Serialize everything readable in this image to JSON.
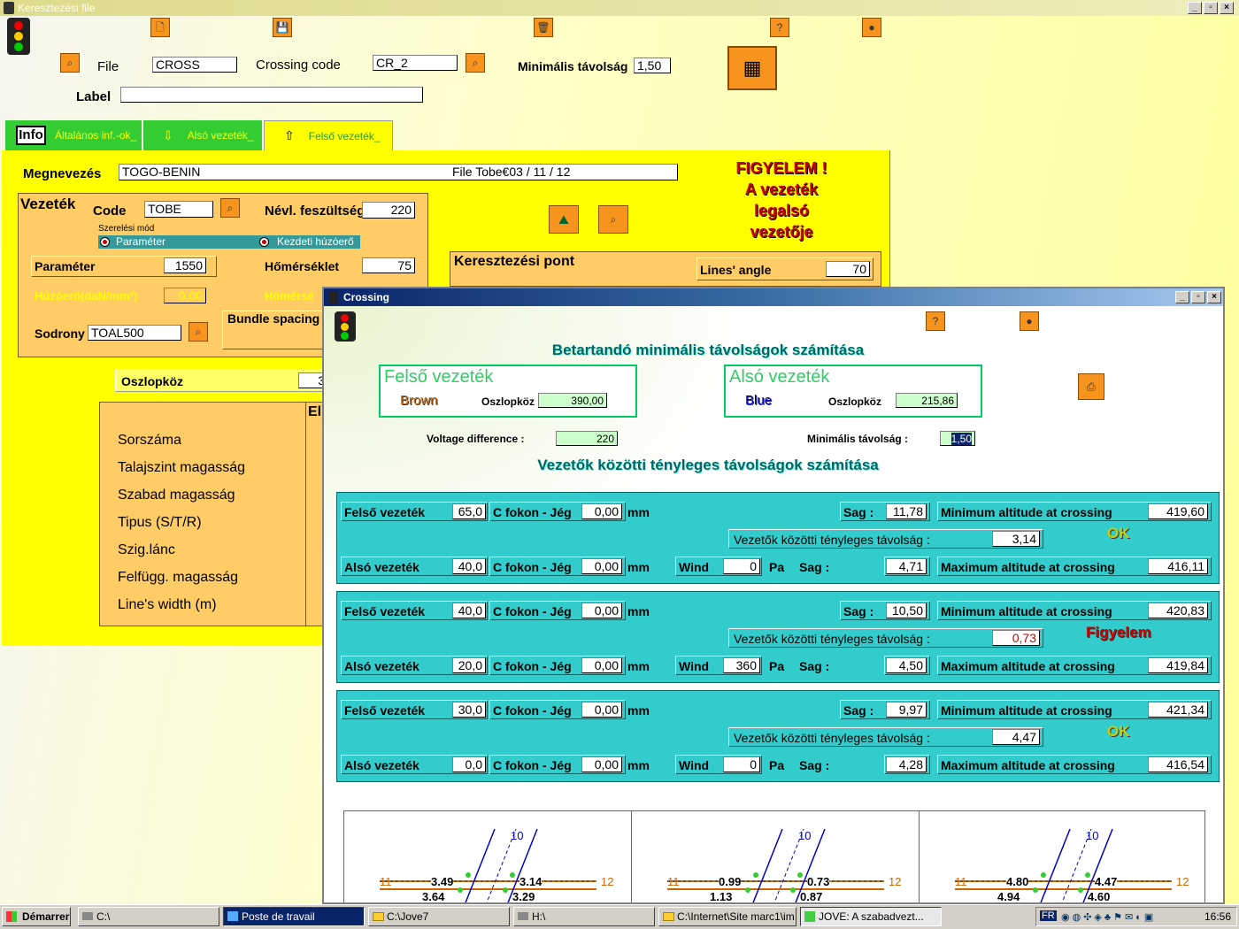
{
  "main_window": {
    "title": "Keresztezési file",
    "file_label": "File",
    "file_value": "CROSS",
    "crossing_code_label": "Crossing code",
    "crossing_code_value": "CR_2",
    "min_dist_label": "Minimális távolság",
    "min_dist_value": "1,50",
    "label_label": "Label",
    "label_value": "",
    "tabs": [
      {
        "label": "Általános inf.-ok_"
      },
      {
        "label": "Alsó vezeték_"
      },
      {
        "label": "Felső vezeték_"
      }
    ],
    "info_badge": "Info",
    "megnevezes_label": "Megnevezés",
    "megnevezes_value": "TOGO-BENIN",
    "megnevezes_file": "File  Tobe€03  /  11  /  12",
    "warning": [
      "FIGYELEM !",
      "A vezeték",
      "legalsó",
      "vezetője"
    ],
    "vezetek_group": "Vezeték",
    "code_label": "Code",
    "code_value": "TOBE",
    "nevl_label": "Névl. feszültség",
    "nevl_value": "220",
    "szereles_label": "Szerelési mód",
    "radio_parameter": "Paraméter",
    "radio_kezdeti": "Kezdeti húzóerő",
    "parameter_label": "Paraméter",
    "parameter_value": "1550",
    "homerseklet_label": "Hőmérséklet",
    "homerseklet_value": "75",
    "huzoero_label": "Húzóerő(daN/mm²)",
    "huzoero_value": "0,00",
    "homersek2_label": "Hőmérsé",
    "bundle_label": "Bundle spacing",
    "sodrony_label": "Sodrony",
    "sodrony_value": "TOAL500",
    "keresztezesi_label": "Keresztezési pont",
    "lines_angle_label": "Lines' angle",
    "lines_angle_value": "70",
    "oszlopkoz_label": "Oszlopköz",
    "oszlopkoz_value": "3",
    "list_header": "El",
    "list_items": [
      "Sorszáma",
      "Talajszint magasság",
      "Szabad magasság",
      "Tipus (S/T/R)",
      "Szig.lánc",
      "Felfügg. magasság",
      "Line's width (m)"
    ]
  },
  "crossing_window": {
    "title": "Crossing",
    "heading1": "Betartandó minimális távolságok számítása",
    "upper_title": "Felső vezeték",
    "upper_color": "Brown",
    "upper_oszlopkoz_label": "Oszlopköz",
    "upper_oszlopkoz_value": "390,00",
    "lower_title": "Alsó vezeték",
    "lower_color": "Blue",
    "lower_oszlopkoz_label": "Oszlopköz",
    "lower_oszlopkoz_value": "215,86",
    "voltage_label": "Voltage difference :",
    "voltage_value": "220",
    "min_label": "Minimális távolság :",
    "min_value": "1,50",
    "heading2": "Vezetők közötti tényleges távolságok számítása",
    "labels": {
      "felso": "Felső vezeték",
      "also": "Alsó vezeték",
      "cfokon": "C fokon - Jég",
      "mm": "mm",
      "sag": "Sag :",
      "wind": "Wind",
      "pa": "Pa",
      "min_alt": "Minimum altitude at crossing",
      "max_alt": "Maximum altitude at crossing",
      "tenyleges": "Vezetők közötti tényleges távolság :"
    },
    "rows": [
      {
        "felso_t": "65,0",
        "felso_jeg": "0,00",
        "felso_sag": "11,78",
        "min_alt": "419,60",
        "dist": "3,14",
        "status": "OK",
        "also_t": "40,0",
        "also_jeg": "0,00",
        "wind": "0",
        "also_sag": "4,71",
        "max_alt": "416,11"
      },
      {
        "felso_t": "40,0",
        "felso_jeg": "0,00",
        "felso_sag": "10,50",
        "min_alt": "420,83",
        "dist": "0,73",
        "status": "Figyelem",
        "also_t": "20,0",
        "also_jeg": "0,00",
        "wind": "360",
        "also_sag": "4,50",
        "max_alt": "419,84"
      },
      {
        "felso_t": "30,0",
        "felso_jeg": "0,00",
        "felso_sag": "9,97",
        "min_alt": "421,34",
        "dist": "4,47",
        "status": "OK",
        "also_t": "0,0",
        "also_jeg": "0,00",
        "wind": "0",
        "also_sag": "4,28",
        "max_alt": "416,54"
      }
    ],
    "diagrams": [
      {
        "top": "10",
        "left": "11",
        "right": "12",
        "a": "3.49",
        "b": "3.14",
        "c": "3.64",
        "d": "3.29"
      },
      {
        "top": "10",
        "left": "11",
        "right": "12",
        "a": "0.99",
        "b": "0.73",
        "c": "1.13",
        "d": "0.87"
      },
      {
        "top": "10",
        "left": "11",
        "right": "12",
        "a": "4.80",
        "b": "4.47",
        "c": "4.94",
        "d": "4.60"
      }
    ]
  },
  "taskbar": {
    "start": "Démarrer",
    "tasks": [
      "C:\\",
      "Poste de travail",
      "C:\\Jove7",
      "H:\\",
      "C:\\Internet\\Site marc1\\im...",
      "JOVE: A szabadvezt..."
    ],
    "lang": "FR",
    "clock": "16:56"
  },
  "colors": {
    "ok": "#cccc00",
    "warn": "#cc0000",
    "teal": "#33cccc",
    "yellow": "#ffff00",
    "orange": "#ffcc66"
  }
}
